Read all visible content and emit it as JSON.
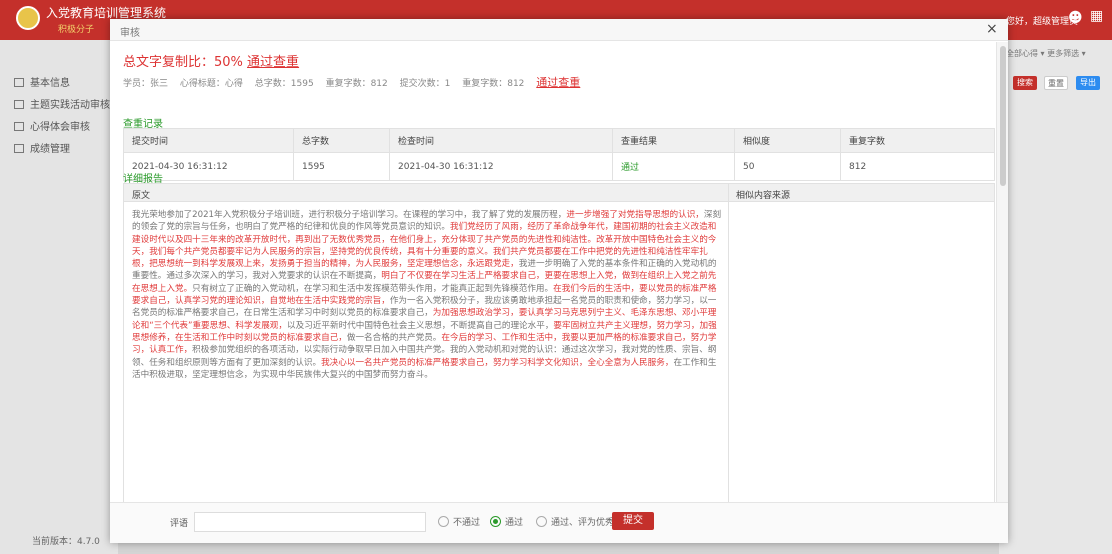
{
  "app": {
    "title": "入党教育培训管理系统",
    "subtitle": "积极分子",
    "user": "您好，超级管理员"
  },
  "sidebar": {
    "items": [
      {
        "label": "基本信息"
      },
      {
        "label": "主题实践活动审核"
      },
      {
        "label": "心得体会审核"
      },
      {
        "label": "成绩管理"
      }
    ],
    "version": "当前版本：4.7.0"
  },
  "background": {
    "filter": "全部心得 ▾   更多筛选 ▾",
    "search": "搜索",
    "reset": "重置",
    "export": "导出"
  },
  "modal": {
    "title": "审核",
    "close": "×",
    "headline_prefix": "总文字复制比：50%",
    "headline_link": "通过查重",
    "meta": {
      "student": "学员：张三",
      "subject": "心得标题：心得",
      "total_chars": "总字数：1595",
      "dup_chars": "重复字数：812",
      "submit_count": "提交次数：1",
      "dup_chars2": "重复字数：812",
      "status": "通过查重"
    },
    "check_section": "查重记录",
    "table": {
      "headers": [
        "提交时间",
        "总字数",
        "检查时间",
        "查重结果",
        "相似度",
        "重复字数"
      ],
      "rows": [
        [
          "2021-04-30 16:31:12",
          "1595",
          "2021-04-30 16:31:12",
          "通过",
          "50",
          "812"
        ]
      ]
    },
    "report_section": "详细报告",
    "report_headers": {
      "original": "原文",
      "similar": "相似内容来源"
    },
    "report_text": [
      [
        "n",
        "我光荣地参加了2021年入党积极分子培训班，进行积极分子培训学习。在课程的学习中，我了解了党的发展历程，"
      ],
      [
        "r",
        "进一步增强了对党指导思想的认识，"
      ],
      [
        "n",
        "深刻的领会了党的宗旨与任务，也明白了党严格的纪律和优良的作风等党员意识的知识。"
      ],
      [
        "r",
        "我们党经历了风雨，经历了革命战争年代，建国初期的社会主义改造和建设时代以及四十三年来的改革开放时代，再到出了无数优秀党员，在他们身上，充分体现了共产党员的先进性和纯洁性。"
      ],
      [
        "r",
        "改革开放中国特色社会主义的今天，我们每个共产党员都要牢记为人民服务的宗旨，坚持党的优良传统，具有十分重要的意义。我们共产党员都要在"
      ],
      [
        "r",
        "工作中把党的先进性和纯洁性牢牢扎根，把思想统一到科学发展观上来，"
      ],
      [
        "r",
        "发扬勇于担当的精神，为人民服务，坚定理想信念，永远跟党走，"
      ],
      [
        "n",
        "我进一步明确了入党的基本条件和正确的入党动机的重要性。通过多次深入的学习，我对入党要求的认识在不断提高，"
      ],
      [
        "r",
        "明白了不仅要在学习生活上严格要求自己，更要在思想上入党，做到在组织上入党之前先在思想上入党。"
      ],
      [
        "n",
        "只有树立了正确的入党动机，在学习和生活中发挥模范带头作用，才能真正起到先锋模范作用。"
      ],
      [
        "r",
        "在我们今后的生活中，要以党员的标准严格要求自己，认真学习党的理论知识，自觉地在生活中实践党的宗旨，"
      ],
      [
        "n",
        "作为一名入党积极分子，我应该勇敢地承担起一名党员的职责和使命，努力学习，以一名党员的标准严格要求自己，在日常生活和学习中时刻以党员的标准要求自己，"
      ],
      [
        "r",
        "为加强思想政治学习，要认真学习马克思列宁主义、毛泽东思想、邓小平理论和“三个代表”重要思想、科学发展观，"
      ],
      [
        "n",
        "以及习近平新时代中国特色社会主义思想，不断提高自己的理论水平，"
      ],
      [
        "r",
        "要牢固树立共产主义理想，努力学习，加强思想修养，在生活和工作中时刻以党员的标准要求自己，"
      ],
      [
        "n",
        "做一名合格的共产党员。"
      ],
      [
        "r",
        "在今后的学习、工作和生活中，我要以更加严格的标准要求自己，努力学习，认真工作，"
      ],
      [
        "n",
        "积极参加党组织的各项活动，以实际行动争取早日加入中国共产党。"
      ],
      [
        "n",
        "我的入党动机和对党的认识：通过这次学习，我对党的性质、宗旨、纲领、任务和组织原则等方面有了更加深刻的认识。"
      ],
      [
        "r",
        "我决心以一名共产党员的标准严格要求自己，努力学习科学文化知识，全心全意为人民服务，"
      ],
      [
        "n",
        "在工作和生活中积极进取，坚定理想信念，为实现中华民族伟大复兴的中国梦而努力奋斗。"
      ]
    ],
    "footer": {
      "comment_label": "评语",
      "options": [
        {
          "label": "不通过",
          "selected": false
        },
        {
          "label": "通过",
          "selected": true
        },
        {
          "label": "通过、评为优秀",
          "selected": false
        }
      ],
      "submit": "提交"
    }
  }
}
